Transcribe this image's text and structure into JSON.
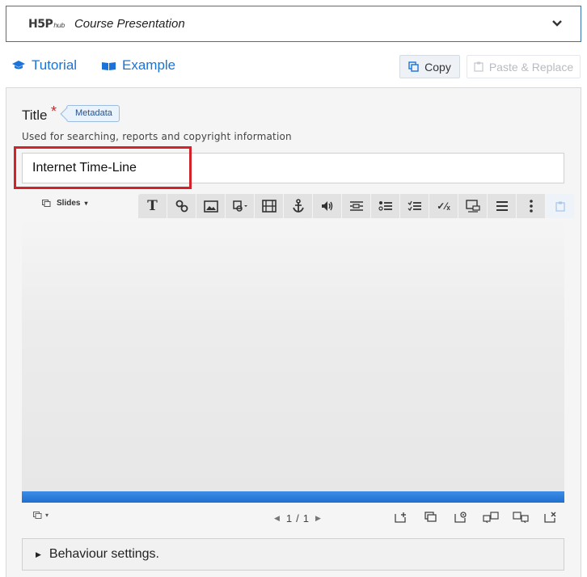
{
  "hub": {
    "logo_main": "H5P",
    "logo_sub": "hub",
    "content_type": "Course Presentation"
  },
  "links": {
    "tutorial": "Tutorial",
    "example": "Example"
  },
  "clipboard": {
    "copy": "Copy",
    "paste_replace": "Paste & Replace"
  },
  "form": {
    "title_label": "Title",
    "required_mark": "*",
    "metadata": "Metadata",
    "help": "Used for searching, reports and copyright information",
    "title_value": "Internet Time-Line"
  },
  "editor": {
    "slides_menu": "Slides",
    "toolbar_icons": [
      "text-icon",
      "link-icon",
      "image-icon",
      "shapes-icon",
      "video-icon",
      "anchor-icon",
      "audio-icon",
      "fill-in-blanks-icon",
      "single-choice-icon",
      "multiple-choice-icon",
      "true-false-icon",
      "drag-and-drop-icon",
      "summary-icon",
      "more-icon",
      "paste-icon"
    ]
  },
  "pager": {
    "current": "1",
    "separator": "/",
    "total": "1"
  },
  "behaviour": {
    "label": "Behaviour settings."
  },
  "colors": {
    "accent": "#1a73d9",
    "highlight": "#d0232a",
    "progress": "#2a7ddc"
  }
}
